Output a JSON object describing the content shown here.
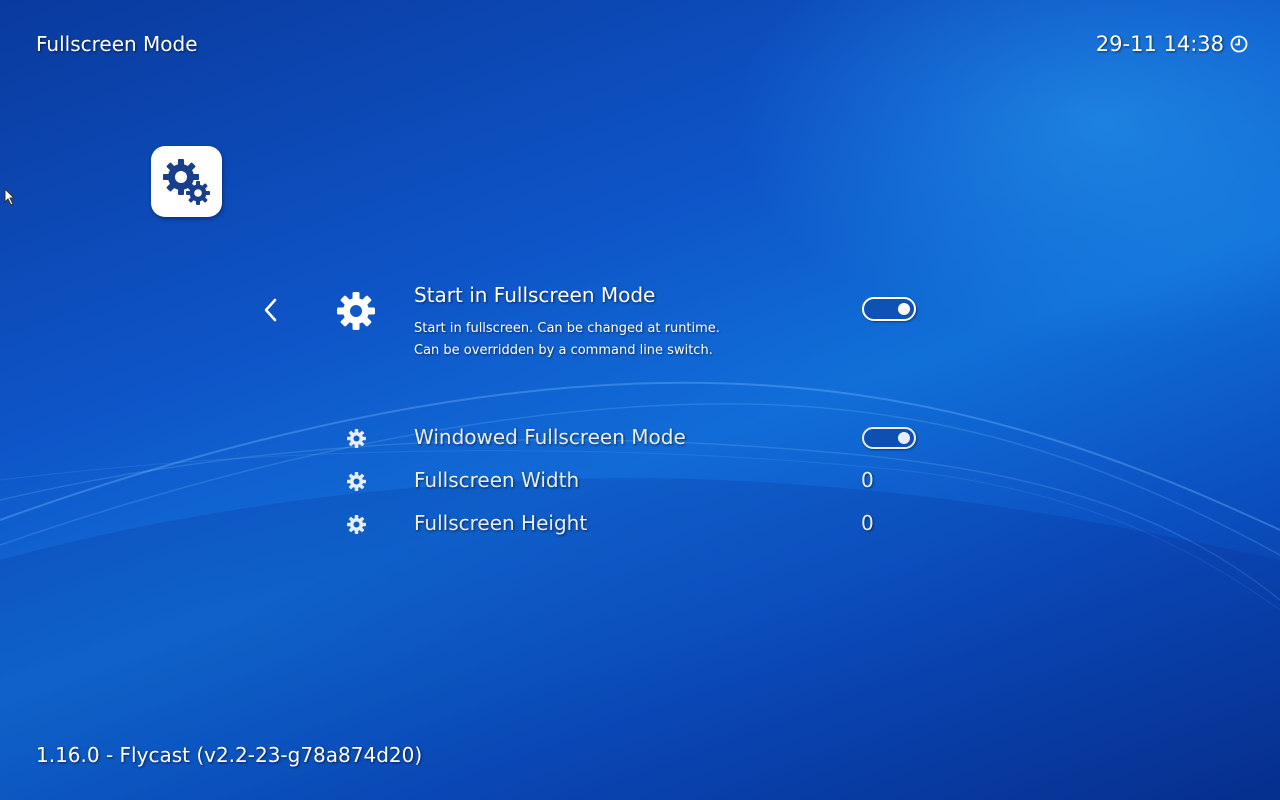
{
  "header": {
    "title": "Fullscreen Mode",
    "clock": "29-11 14:38",
    "clock_icon": "clock-icon"
  },
  "menu_icon": "settings-gears-icon",
  "settings": [
    {
      "label": "Start in Fullscreen Mode",
      "sublabel_line1": "Start in fullscreen. Can be changed at runtime.",
      "sublabel_line2": "Can be overridden by a command line switch.",
      "type": "toggle",
      "enabled": true,
      "selected": true
    },
    {
      "label": "Windowed Fullscreen Mode",
      "type": "toggle",
      "enabled": true,
      "selected": false
    },
    {
      "label": "Fullscreen Width",
      "type": "value",
      "value": "0",
      "selected": false
    },
    {
      "label": "Fullscreen Height",
      "type": "value",
      "value": "0",
      "selected": false
    }
  ],
  "footer": {
    "version": "1.16.0 - Flycast (v2.2-23-g78a874d20)"
  },
  "colors": {
    "background_top": "#0a3a9e",
    "background_mid": "#1170d8",
    "tile_icon": "#1a3f8a",
    "text": "#ffffff"
  }
}
